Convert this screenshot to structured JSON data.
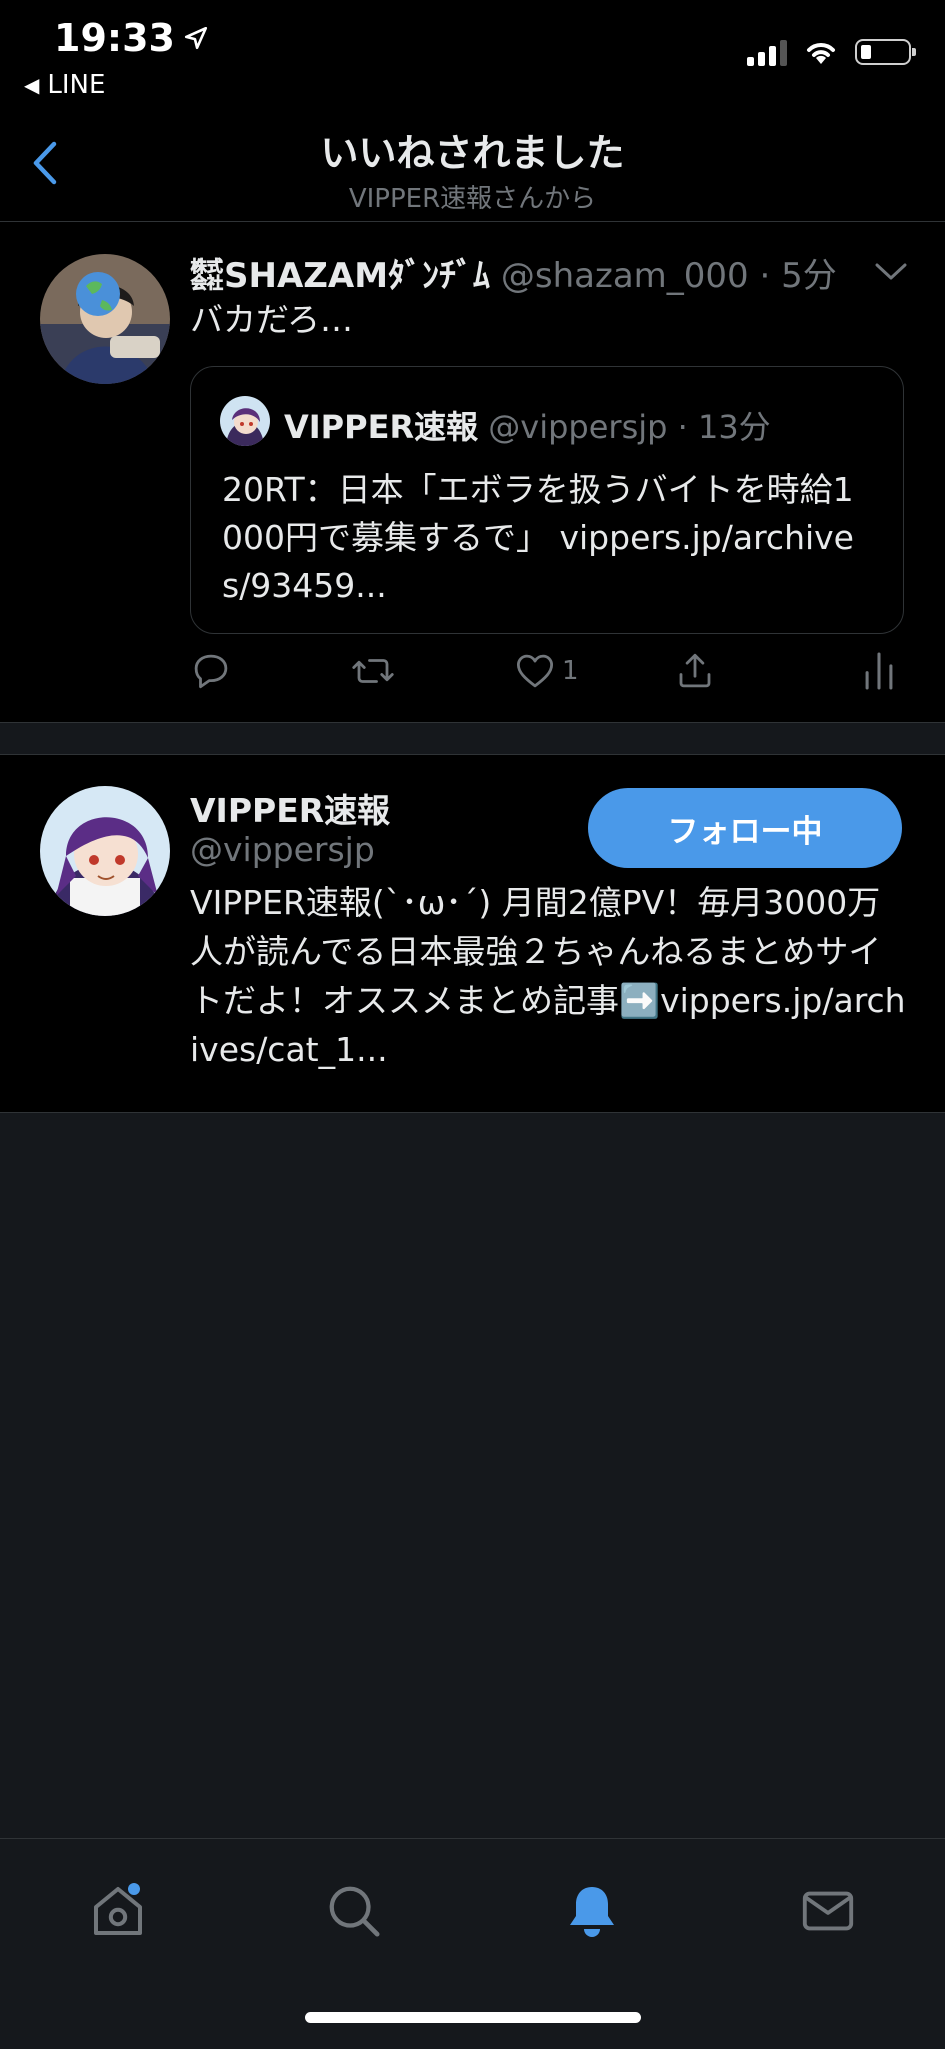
{
  "status_bar": {
    "time": "19:33",
    "back_app": "LINE"
  },
  "nav": {
    "title": "いいねされました",
    "subtitle": "VIPPER速報さんから"
  },
  "tweet": {
    "author_name": "㍿SHAZAMﾀﾞﾝﾁﾞﾑ",
    "author_handle": "@shazam_000",
    "time": "5分",
    "separator": "·",
    "text": "バカだろ…",
    "quote": {
      "author_name": "VIPPER速報",
      "author_handle": "@vippersjp",
      "time": "13分",
      "text": "20RT：日本「エボラを扱うバイトを時給1000円で募集するで」 vippers.jp/archives/93459..."
    },
    "like_count": "1"
  },
  "user_card": {
    "name": "VIPPER速報",
    "handle": "@vippersjp",
    "follow_label": "フォロー中",
    "bio": "VIPPER速報(`･ω･´) 月間2億PV！毎月3000万人が読んでる日本最強２ちゃんねるまとめサイトだよ！オススメまとめ記事➡️vippers.jp/archives/cat_1..."
  },
  "tabs": [
    {
      "name": "home",
      "icon": "home-icon",
      "active": false,
      "badge": true
    },
    {
      "name": "search",
      "icon": "search-icon",
      "active": false
    },
    {
      "name": "notifications",
      "icon": "bell-icon",
      "active": true
    },
    {
      "name": "messages",
      "icon": "mail-icon",
      "active": false
    }
  ],
  "colors": {
    "accent": "#4a99e9",
    "background": "#000000",
    "muted": "#71767b"
  }
}
